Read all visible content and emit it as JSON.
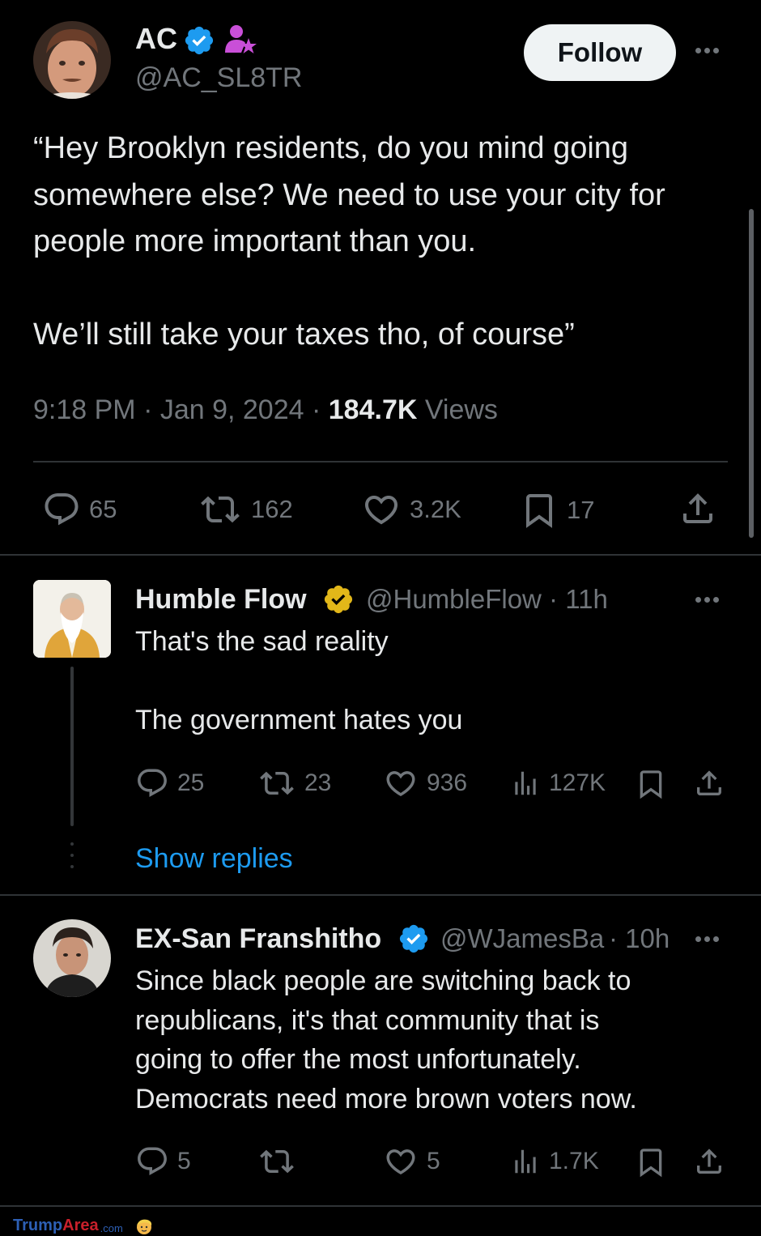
{
  "main_tweet": {
    "author_name": "AC",
    "author_handle": "@AC_SL8TR",
    "follow_label": "Follow",
    "text": "“Hey Brooklyn residents, do you mind going\nsomewhere else? We need to use your city for\npeople more important than you.\n\nWe’ll still take your taxes tho, of course”",
    "time": "9:18 PM · Jan 9, 2024 · ",
    "views_count": "184.7K",
    "views_label": " Views",
    "stats": {
      "replies": "65",
      "reposts": "162",
      "likes": "3.2K",
      "bookmarks": "17"
    }
  },
  "replies": [
    {
      "author_name": "Humble Flow",
      "author_handle": "@HumbleFlow · 11h",
      "text": "That's the sad reality\n\nThe government hates you",
      "stats": {
        "replies": "25",
        "reposts": "23",
        "likes": "936",
        "views": "127K"
      },
      "show_replies": "Show replies"
    },
    {
      "author_name": "EX-San Franshitho",
      "author_handle": "@WJamesBa",
      "time": "· 10h",
      "text": "Since black people are switching back to\nrepublicans, it's that community that is\ngoing to offer the most unfortunately.\nDemocrats need more brown voters now.",
      "stats": {
        "replies": "5",
        "reposts": "",
        "likes": "5",
        "views": "1.7K"
      }
    }
  ],
  "watermark": {
    "part1": "Trump",
    "part2": "Area",
    "part3": ".com"
  },
  "colors": {
    "background": "#000000",
    "text": "#e7e9ea",
    "muted": "#71767b",
    "link": "#1d9bf0",
    "verified_blue": "#1d9bf0",
    "verified_gold": "#e2b719",
    "divider": "#2f3336",
    "follow_bg": "#eff3f4"
  },
  "icons": [
    "verified-badge-icon",
    "subscriber-badge-icon",
    "more-icon",
    "reply-icon",
    "repost-icon",
    "like-icon",
    "bookmark-icon",
    "share-icon",
    "views-icon"
  ]
}
